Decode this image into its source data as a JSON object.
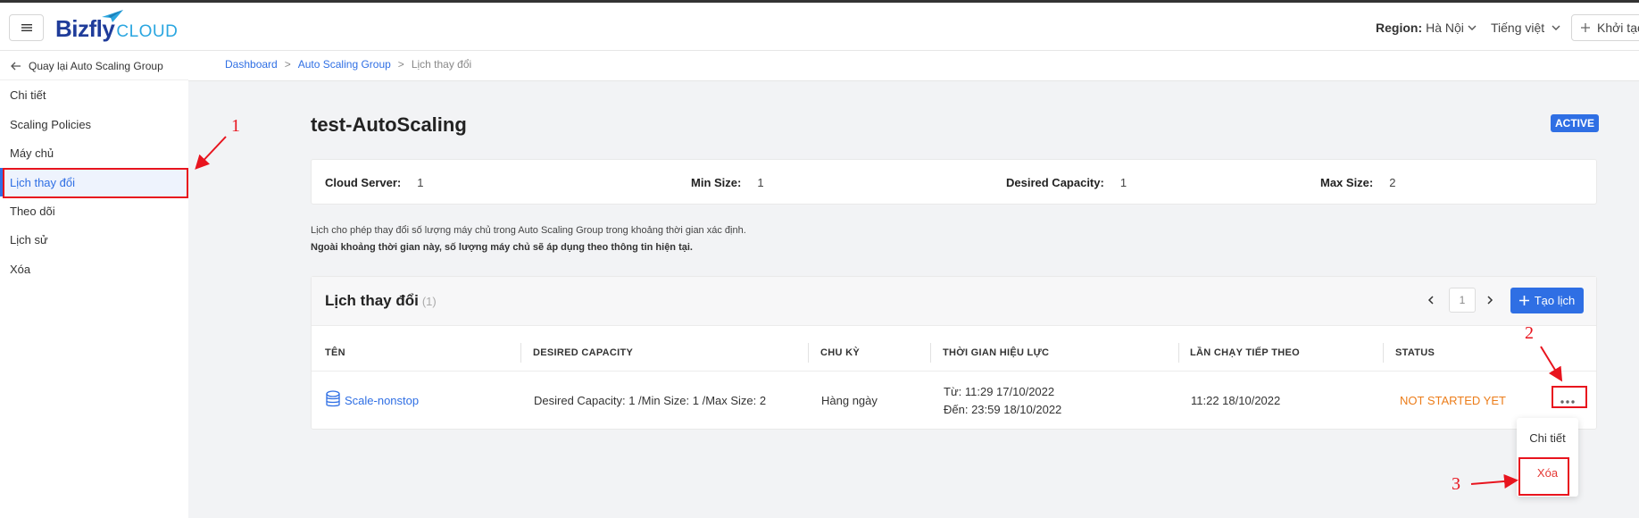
{
  "header": {
    "logo_text": "Bizfly",
    "logo_sub": "CLOUD",
    "region_label": "Region:",
    "region_value": "Hà Nội",
    "language": "Tiếng việt",
    "create_label": "Khởi tạo"
  },
  "sidebar": {
    "back_label": "Quay lại Auto Scaling Group",
    "items": [
      {
        "label": "Chi tiết"
      },
      {
        "label": "Scaling Policies"
      },
      {
        "label": "Máy chủ"
      },
      {
        "label": "Lịch thay đổi"
      },
      {
        "label": "Theo dõi"
      },
      {
        "label": "Lịch sử"
      },
      {
        "label": "Xóa"
      }
    ]
  },
  "breadcrumb": {
    "items": [
      "Dashboard",
      "Auto Scaling Group",
      "Lịch thay đổi"
    ],
    "separator": ">"
  },
  "page": {
    "title": "test-AutoScaling",
    "status_badge": "ACTIVE"
  },
  "stats": [
    {
      "label": "Cloud Server:",
      "value": "1"
    },
    {
      "label": "Min Size:",
      "value": "1"
    },
    {
      "label": "Desired Capacity:",
      "value": "1"
    },
    {
      "label": "Max Size:",
      "value": "2"
    }
  ],
  "notes": {
    "line1": "Lịch cho phép thay đổi số lượng máy chủ trong Auto Scaling Group trong khoảng thời gian xác định.",
    "line2": "Ngoài khoảng thời gian này, số lượng máy chủ sẽ áp dụng theo thông tin hiện tại."
  },
  "schedule_card": {
    "title": "Lịch thay đổi",
    "count": "(1)",
    "page": "1",
    "create_button": "Tạo lịch",
    "columns": [
      "TÊN",
      "DESIRED CAPACITY",
      "CHU KỲ",
      "THỜI GIAN HIỆU LỰC",
      "LẦN CHẠY TIẾP THEO",
      "STATUS"
    ],
    "rows": [
      {
        "name": "Scale-nonstop",
        "desired_capacity": "Desired Capacity: 1 /Min Size: 1 /Max Size: 2",
        "cycle": "Hàng ngày",
        "valid_from": "Từ: 11:29 17/10/2022",
        "valid_to": "Đến: 23:59 18/10/2022",
        "next_run": "11:22 18/10/2022",
        "status": "NOT STARTED YET"
      }
    ]
  },
  "row_menu": {
    "items": [
      "Chi tiết",
      "Xóa"
    ]
  },
  "annotations": {
    "labels": [
      "1",
      "2",
      "3"
    ],
    "color": "#e8141e"
  },
  "colors": {
    "accent": "#2f6fe4",
    "status_warning": "#ec7d1a",
    "danger": "#e53935"
  }
}
